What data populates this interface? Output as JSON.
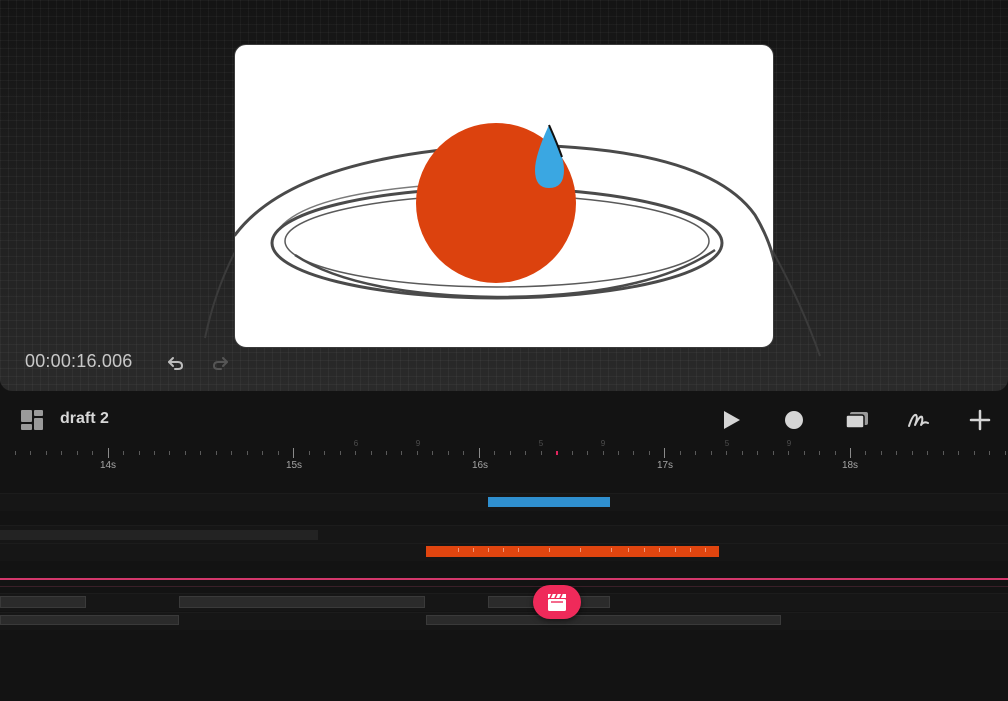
{
  "canvas": {
    "timecode": "00:00:16.006",
    "background_color": "#1f1f1f",
    "frame_color": "#ffffff"
  },
  "artwork": {
    "ball_color": "#dc420e",
    "drop_color": "#3aa7e2",
    "sketch_color": "#4a4a4a"
  },
  "toolbar": {
    "project_title": "draft 2",
    "icons": [
      "layout-icon",
      "play-icon",
      "record-icon",
      "layers-icon",
      "draw-icon",
      "add-icon"
    ]
  },
  "ruler": {
    "labels": [
      "14s",
      "15s",
      "16s",
      "17s",
      "18s"
    ],
    "frame_numbers": [
      "6",
      "9",
      "5",
      "9",
      "5",
      "9"
    ]
  },
  "timeline": {
    "accent_color": "#ef2a5a",
    "clip_colors": {
      "orange": "#e0450f",
      "blue": "#2f8fcf"
    },
    "badge_icon": "clapperboard-icon"
  }
}
